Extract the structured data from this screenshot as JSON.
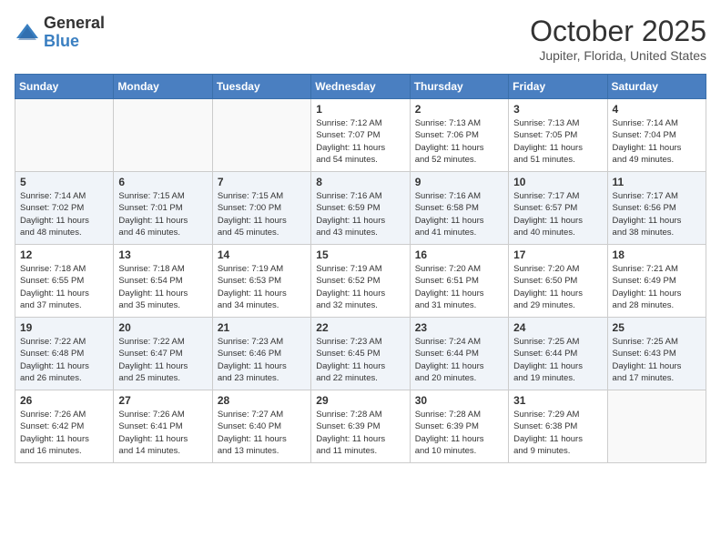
{
  "header": {
    "logo_general": "General",
    "logo_blue": "Blue",
    "month": "October 2025",
    "location": "Jupiter, Florida, United States"
  },
  "weekdays": [
    "Sunday",
    "Monday",
    "Tuesday",
    "Wednesday",
    "Thursday",
    "Friday",
    "Saturday"
  ],
  "weeks": [
    [
      {
        "day": "",
        "info": ""
      },
      {
        "day": "",
        "info": ""
      },
      {
        "day": "",
        "info": ""
      },
      {
        "day": "1",
        "info": "Sunrise: 7:12 AM\nSunset: 7:07 PM\nDaylight: 11 hours\nand 54 minutes."
      },
      {
        "day": "2",
        "info": "Sunrise: 7:13 AM\nSunset: 7:06 PM\nDaylight: 11 hours\nand 52 minutes."
      },
      {
        "day": "3",
        "info": "Sunrise: 7:13 AM\nSunset: 7:05 PM\nDaylight: 11 hours\nand 51 minutes."
      },
      {
        "day": "4",
        "info": "Sunrise: 7:14 AM\nSunset: 7:04 PM\nDaylight: 11 hours\nand 49 minutes."
      }
    ],
    [
      {
        "day": "5",
        "info": "Sunrise: 7:14 AM\nSunset: 7:02 PM\nDaylight: 11 hours\nand 48 minutes."
      },
      {
        "day": "6",
        "info": "Sunrise: 7:15 AM\nSunset: 7:01 PM\nDaylight: 11 hours\nand 46 minutes."
      },
      {
        "day": "7",
        "info": "Sunrise: 7:15 AM\nSunset: 7:00 PM\nDaylight: 11 hours\nand 45 minutes."
      },
      {
        "day": "8",
        "info": "Sunrise: 7:16 AM\nSunset: 6:59 PM\nDaylight: 11 hours\nand 43 minutes."
      },
      {
        "day": "9",
        "info": "Sunrise: 7:16 AM\nSunset: 6:58 PM\nDaylight: 11 hours\nand 41 minutes."
      },
      {
        "day": "10",
        "info": "Sunrise: 7:17 AM\nSunset: 6:57 PM\nDaylight: 11 hours\nand 40 minutes."
      },
      {
        "day": "11",
        "info": "Sunrise: 7:17 AM\nSunset: 6:56 PM\nDaylight: 11 hours\nand 38 minutes."
      }
    ],
    [
      {
        "day": "12",
        "info": "Sunrise: 7:18 AM\nSunset: 6:55 PM\nDaylight: 11 hours\nand 37 minutes."
      },
      {
        "day": "13",
        "info": "Sunrise: 7:18 AM\nSunset: 6:54 PM\nDaylight: 11 hours\nand 35 minutes."
      },
      {
        "day": "14",
        "info": "Sunrise: 7:19 AM\nSunset: 6:53 PM\nDaylight: 11 hours\nand 34 minutes."
      },
      {
        "day": "15",
        "info": "Sunrise: 7:19 AM\nSunset: 6:52 PM\nDaylight: 11 hours\nand 32 minutes."
      },
      {
        "day": "16",
        "info": "Sunrise: 7:20 AM\nSunset: 6:51 PM\nDaylight: 11 hours\nand 31 minutes."
      },
      {
        "day": "17",
        "info": "Sunrise: 7:20 AM\nSunset: 6:50 PM\nDaylight: 11 hours\nand 29 minutes."
      },
      {
        "day": "18",
        "info": "Sunrise: 7:21 AM\nSunset: 6:49 PM\nDaylight: 11 hours\nand 28 minutes."
      }
    ],
    [
      {
        "day": "19",
        "info": "Sunrise: 7:22 AM\nSunset: 6:48 PM\nDaylight: 11 hours\nand 26 minutes."
      },
      {
        "day": "20",
        "info": "Sunrise: 7:22 AM\nSunset: 6:47 PM\nDaylight: 11 hours\nand 25 minutes."
      },
      {
        "day": "21",
        "info": "Sunrise: 7:23 AM\nSunset: 6:46 PM\nDaylight: 11 hours\nand 23 minutes."
      },
      {
        "day": "22",
        "info": "Sunrise: 7:23 AM\nSunset: 6:45 PM\nDaylight: 11 hours\nand 22 minutes."
      },
      {
        "day": "23",
        "info": "Sunrise: 7:24 AM\nSunset: 6:44 PM\nDaylight: 11 hours\nand 20 minutes."
      },
      {
        "day": "24",
        "info": "Sunrise: 7:25 AM\nSunset: 6:44 PM\nDaylight: 11 hours\nand 19 minutes."
      },
      {
        "day": "25",
        "info": "Sunrise: 7:25 AM\nSunset: 6:43 PM\nDaylight: 11 hours\nand 17 minutes."
      }
    ],
    [
      {
        "day": "26",
        "info": "Sunrise: 7:26 AM\nSunset: 6:42 PM\nDaylight: 11 hours\nand 16 minutes."
      },
      {
        "day": "27",
        "info": "Sunrise: 7:26 AM\nSunset: 6:41 PM\nDaylight: 11 hours\nand 14 minutes."
      },
      {
        "day": "28",
        "info": "Sunrise: 7:27 AM\nSunset: 6:40 PM\nDaylight: 11 hours\nand 13 minutes."
      },
      {
        "day": "29",
        "info": "Sunrise: 7:28 AM\nSunset: 6:39 PM\nDaylight: 11 hours\nand 11 minutes."
      },
      {
        "day": "30",
        "info": "Sunrise: 7:28 AM\nSunset: 6:39 PM\nDaylight: 11 hours\nand 10 minutes."
      },
      {
        "day": "31",
        "info": "Sunrise: 7:29 AM\nSunset: 6:38 PM\nDaylight: 11 hours\nand 9 minutes."
      },
      {
        "day": "",
        "info": ""
      }
    ]
  ]
}
